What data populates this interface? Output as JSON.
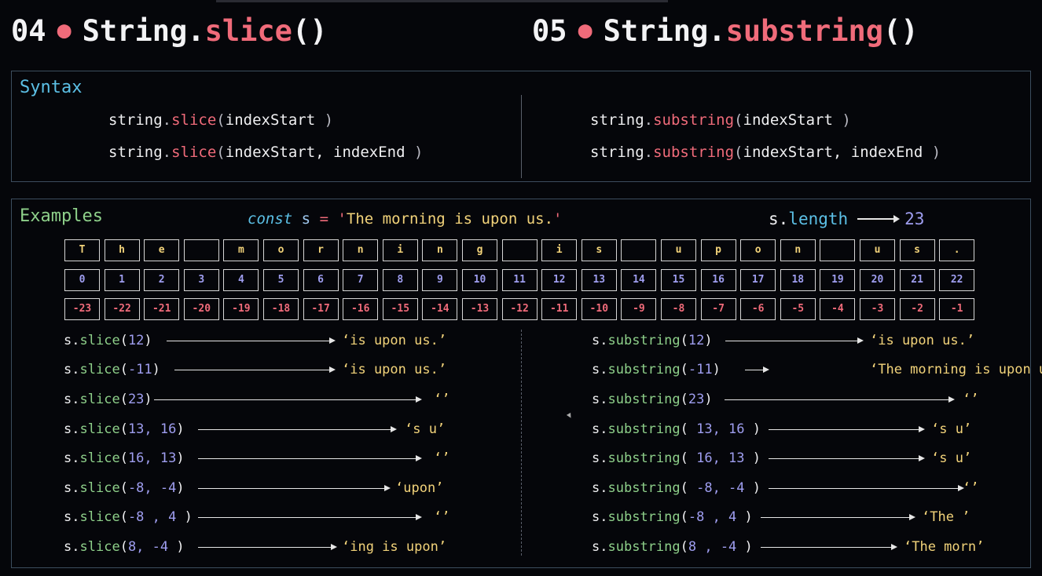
{
  "headings": {
    "left": {
      "num": "04",
      "dot": "●",
      "obj": "String.",
      "method": "slice",
      "parens": "()"
    },
    "right": {
      "num": "05",
      "dot": "●",
      "obj": "String.",
      "method": "substring",
      "parens": "()"
    }
  },
  "syntax": {
    "title": "Syntax",
    "slice_line1": {
      "obj": "string",
      "dot": ".",
      "method": "slice",
      "open": "(",
      "args": "indexStart",
      "close": " )"
    },
    "slice_line2": {
      "obj": "string",
      "dot": ".",
      "method": "slice",
      "open": "(",
      "args": "indexStart, indexEnd",
      "close": " )"
    },
    "sub_line1": {
      "obj": "string",
      "dot": ".",
      "method": "substring",
      "open": "(",
      "args": "indexStart",
      "close": " )"
    },
    "sub_line2": {
      "obj": "string",
      "dot": ".",
      "method": "substring",
      "open": "(",
      "args": "indexStart, indexEnd",
      "close": " )"
    }
  },
  "examples": {
    "title": "Examples",
    "const_kw": "const",
    "const_var": "s",
    "const_eq": "=",
    "const_q1": "'",
    "const_value": "The morning is upon us.",
    "const_q2": "'",
    "length_obj": "s.",
    "length_prop": "length",
    "length_value": "23",
    "chars": [
      "T",
      "h",
      "e",
      "",
      "m",
      "o",
      "r",
      "n",
      "i",
      "n",
      "g",
      "",
      "i",
      "s",
      "",
      "u",
      "p",
      "o",
      "n",
      "",
      "u",
      "s",
      "."
    ],
    "pos_index": [
      "0",
      "1",
      "2",
      "3",
      "4",
      "5",
      "6",
      "7",
      "8",
      "9",
      "10",
      "11",
      "12",
      "13",
      "14",
      "15",
      "16",
      "17",
      "18",
      "19",
      "20",
      "21",
      "22"
    ],
    "neg_index": [
      "-23",
      "-22",
      "-21",
      "-20",
      "-19",
      "-18",
      "-17",
      "-16",
      "-15",
      "-14",
      "-13",
      "-12",
      "-11",
      "-10",
      "-9",
      "-8",
      "-7",
      "-6",
      "-5",
      "-4",
      "-3",
      "-2",
      "-1"
    ],
    "slice_calls": [
      {
        "s": "s",
        "dot": ".",
        "method": "slice",
        "open": "(",
        "args": "12",
        "close": ")",
        "result": "‘is upon us.’"
      },
      {
        "s": "s",
        "dot": ".",
        "method": "slice",
        "open": "(",
        "args": "-11",
        "close": ")",
        "result": "‘is upon us.’"
      },
      {
        "s": "s",
        "dot": ".",
        "method": "slice",
        "open": "(",
        "args": "23",
        "close": ")",
        "result": "‘’"
      },
      {
        "s": "s",
        "dot": ".",
        "method": "slice",
        "open": "(",
        "args": "13, 16",
        "close": ")",
        "result": "‘s u’"
      },
      {
        "s": "s",
        "dot": ".",
        "method": "slice",
        "open": "(",
        "args": "16, 13",
        "close": ")",
        "result": "‘’"
      },
      {
        "s": "s",
        "dot": ".",
        "method": "slice",
        "open": "(",
        "args": "-8, -4",
        "close": ")",
        "result": "‘upon’"
      },
      {
        "s": "s",
        "dot": ".",
        "method": "slice",
        "open": "(",
        "args": "-8 , 4",
        "close": " )",
        "result": "‘’"
      },
      {
        "s": "s",
        "dot": ".",
        "method": "slice",
        "open": "(",
        "args": "8, -4",
        "close": " )",
        "result": "‘ing is upon’"
      }
    ],
    "substring_calls": [
      {
        "s": "s",
        "dot": ".",
        "method": "substring",
        "open": "(",
        "args": "12",
        "close": ")",
        "result": "‘is upon us.’"
      },
      {
        "s": "s",
        "dot": ".",
        "method": "substring",
        "open": "(",
        "args": "-11",
        "close": ")",
        "result": "‘The morning is upon us.’"
      },
      {
        "s": "s",
        "dot": ".",
        "method": "substring",
        "open": "(",
        "args": "23",
        "close": ")",
        "result": "‘’"
      },
      {
        "s": "s",
        "dot": ".",
        "method": "substring",
        "open": "( ",
        "args": "13, 16",
        "close": " )",
        "result": "‘s u’"
      },
      {
        "s": "s",
        "dot": ".",
        "method": "substring",
        "open": "( ",
        "args": "16, 13",
        "close": " )",
        "result": "‘s u’"
      },
      {
        "s": "s",
        "dot": ".",
        "method": "substring",
        "open": "( ",
        "args": "-8, -4",
        "close": " )",
        "result": "‘’"
      },
      {
        "s": "s",
        "dot": ".",
        "method": "substring",
        "open": "(",
        "args": "-8 , 4",
        "close": " )",
        "result": "‘The ’"
      },
      {
        "s": "s",
        "dot": ".",
        "method": "substring",
        "open": "(",
        "args": "8 , -4",
        "close": " )",
        "result": "‘The morn’"
      }
    ]
  },
  "colors": {
    "background": "#05060a",
    "method_pink": "#f06b7a",
    "keyword_cyan": "#5cc0e6",
    "examples_green": "#8ed08a",
    "number_purple": "#9f9ef0",
    "string_yellow": "#f2d37a"
  }
}
